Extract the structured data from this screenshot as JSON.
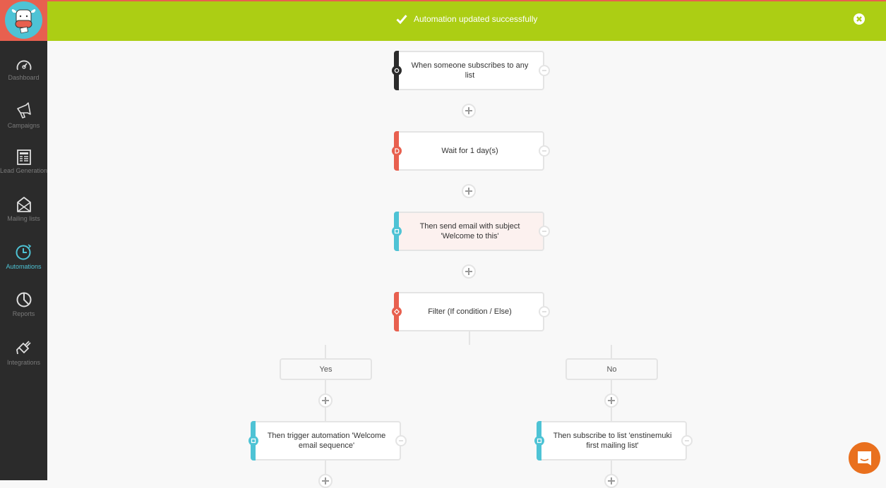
{
  "colors": {
    "banner": "#acce14",
    "sidebar": "#2b2b2b",
    "logo_bg": "#e8604f",
    "accent": "#4ec3d5",
    "trigger": "#2b2b2b",
    "delay": "#e8604f",
    "action": "#4ec3d5",
    "chat": "#e9701e"
  },
  "sidebar": {
    "logo": "cow-logo",
    "items": [
      {
        "label": "Dashboard",
        "icon": "gauge-icon",
        "active": false
      },
      {
        "label": "Campaigns",
        "icon": "megaphone-icon",
        "active": false
      },
      {
        "label": "Lead Generation",
        "icon": "form-icon",
        "active": false
      },
      {
        "label": "Mailing lists",
        "icon": "envelope-icon",
        "active": false
      },
      {
        "label": "Automations",
        "icon": "clock-icon",
        "active": true
      },
      {
        "label": "Reports",
        "icon": "pie-chart-icon",
        "active": false
      },
      {
        "label": "Integrations",
        "icon": "plug-icon",
        "active": false
      }
    ]
  },
  "banner": {
    "message": "Automation updated successfully",
    "icon": "check-icon",
    "close_icon": "close-circle-icon"
  },
  "workflow": {
    "nodes": [
      {
        "type": "trigger",
        "text": "When someone subscribes to any list"
      },
      {
        "type": "delay",
        "text": "Wait for 1 day(s)"
      },
      {
        "type": "action",
        "text": "Then send email with subject 'Welcome to this'"
      },
      {
        "type": "filter",
        "text": "Filter (If condition / Else)"
      }
    ],
    "branches": [
      {
        "label": "Yes",
        "node": {
          "type": "action",
          "text": "Then trigger automation 'Welcome email sequence'"
        }
      },
      {
        "label": "No",
        "node": {
          "type": "action",
          "text": "Then subscribe to list 'enstinemuki first mailing list'"
        }
      }
    ]
  },
  "chat_widget": {
    "icon": "chat-bubble-icon"
  }
}
